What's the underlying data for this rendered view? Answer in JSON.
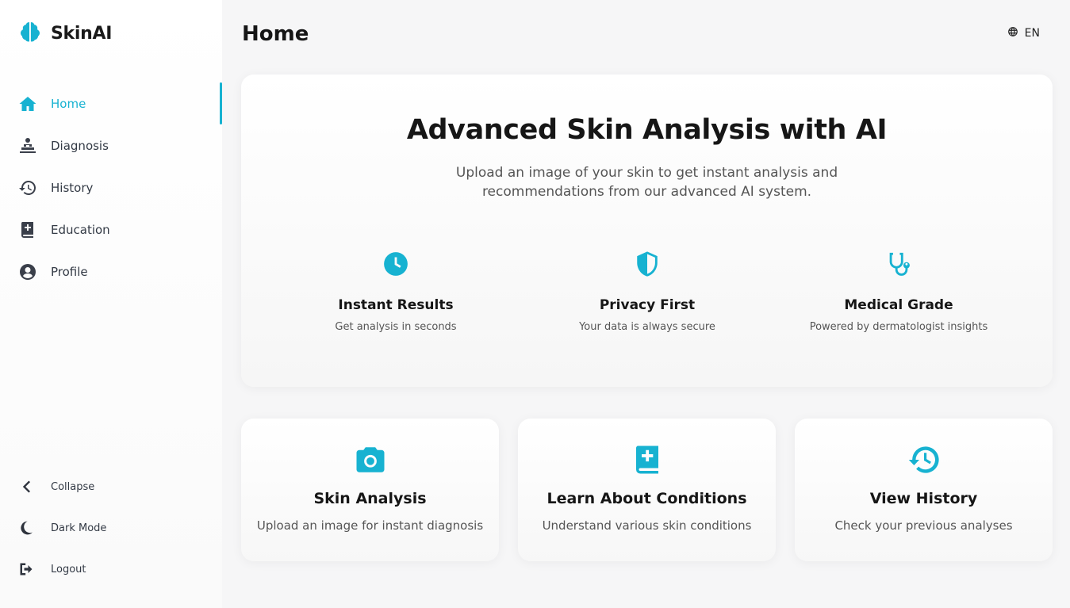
{
  "app": {
    "name": "SkinAI",
    "logo_icon": "brain-icon"
  },
  "sidebar": {
    "items": [
      {
        "label": "Home",
        "icon": "home-icon",
        "active": true
      },
      {
        "label": "Diagnosis",
        "icon": "diagnosis-icon",
        "active": false
      },
      {
        "label": "History",
        "icon": "history-icon",
        "active": false
      },
      {
        "label": "Education",
        "icon": "book-medical-icon",
        "active": false
      },
      {
        "label": "Profile",
        "icon": "user-circle-icon",
        "active": false
      }
    ],
    "bottom": [
      {
        "label": "Collapse",
        "icon": "chevron-left-icon"
      },
      {
        "label": "Dark Mode",
        "icon": "moon-icon"
      },
      {
        "label": "Logout",
        "icon": "logout-icon"
      }
    ]
  },
  "header": {
    "title": "Home",
    "language": "EN",
    "language_icon": "globe-icon"
  },
  "hero": {
    "title": "Advanced Skin Analysis with AI",
    "subtitle": "Upload an image of your skin to get instant analysis and recommendations from our advanced AI system.",
    "features": [
      {
        "title": "Instant Results",
        "description": "Get analysis in seconds",
        "icon": "clock-icon"
      },
      {
        "title": "Privacy First",
        "description": "Your data is always secure",
        "icon": "shield-icon"
      },
      {
        "title": "Medical Grade",
        "description": "Powered by dermatologist insights",
        "icon": "stethoscope-icon"
      }
    ]
  },
  "cards": [
    {
      "title": "Skin Analysis",
      "description": "Upload an image for instant diagnosis",
      "icon": "camera-icon"
    },
    {
      "title": "Learn About Conditions",
      "description": "Understand various skin conditions",
      "icon": "book-medical-icon"
    },
    {
      "title": "View History",
      "description": "Check your previous analyses",
      "icon": "history-icon"
    }
  ],
  "colors": {
    "accent": "#17b2d1",
    "text": "#161616",
    "muted": "#555555",
    "background": "#f6f6f7"
  }
}
